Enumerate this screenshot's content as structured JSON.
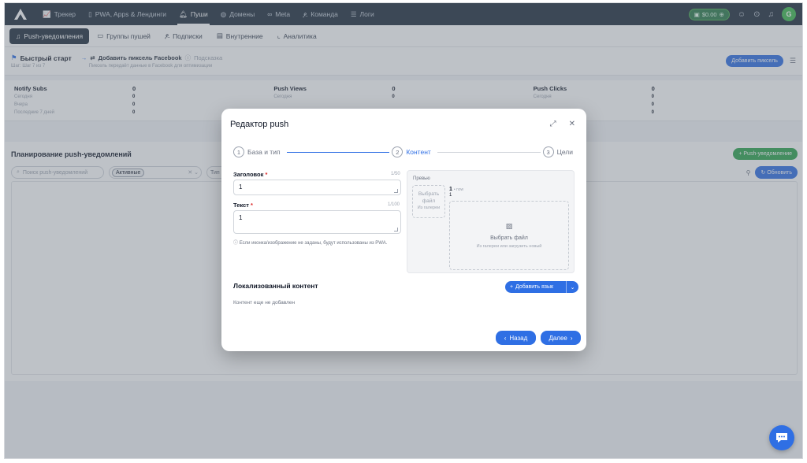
{
  "topnav": {
    "items": [
      {
        "label": "Трекер",
        "icon": "chart-line-icon"
      },
      {
        "label": "PWA, Apps & Лендинги",
        "icon": "phone-icon"
      },
      {
        "label": "Пуши",
        "icon": "bell-icon"
      },
      {
        "label": "Домены",
        "icon": "globe-icon"
      },
      {
        "label": "Meta",
        "icon": "meta-icon"
      },
      {
        "label": "Команда",
        "icon": "team-icon"
      },
      {
        "label": "Логи",
        "icon": "list-icon"
      }
    ],
    "balance": "$0.00",
    "avatar": "G"
  },
  "subnav": {
    "items": [
      {
        "label": "Push-уведомления"
      },
      {
        "label": "Группы пушей"
      },
      {
        "label": "Подписки"
      },
      {
        "label": "Внутренние"
      },
      {
        "label": "Аналитика"
      }
    ]
  },
  "quickstart": {
    "title": "Быстрый старт",
    "step": "Шаг: Шаг 7 из 7",
    "action": "Добавить пиксель Facebook",
    "hint": "Подсказка",
    "desc": "Пиксель передаёт данные в Facebook для оптимизации",
    "button": "Добавить пиксель"
  },
  "stats": [
    {
      "title": "Notify Subs",
      "rows": [
        {
          "label": "Сегодня",
          "value": "0"
        },
        {
          "label": "Вчера",
          "value": "0"
        },
        {
          "label": "Последние 7 дней",
          "value": "0"
        }
      ],
      "head_value": "0"
    },
    {
      "title": "Push Views",
      "rows": [
        {
          "label": "Сегодня",
          "value": "0"
        },
        {
          "label": "",
          "value": ""
        },
        {
          "label": "",
          "value": ""
        }
      ],
      "head_value": "0"
    },
    {
      "title": "Push Clicks",
      "rows": [
        {
          "label": "Сегодня",
          "value": "0"
        },
        {
          "label": "",
          "value": "0"
        },
        {
          "label": "",
          "value": "0"
        }
      ],
      "head_value": "0"
    }
  ],
  "planning": {
    "title": "Планирование push-уведомлений",
    "search_placeholder": "Поиск push-уведомлений",
    "status_tag": "Активные",
    "type_placeholder": "Тип",
    "new_button": "Push-уведомление",
    "refresh_button": "Обновить"
  },
  "modal": {
    "title": "Редактор push",
    "steps": [
      {
        "num": "1",
        "label": "База и тип"
      },
      {
        "num": "2",
        "label": "Контент"
      },
      {
        "num": "3",
        "label": "Цели"
      }
    ],
    "heading_label": "Заголовок",
    "heading_counter": "1/50",
    "heading_value": "1",
    "text_label": "Текст",
    "text_counter": "1/100",
    "text_value": "1",
    "required_mark": "*",
    "note": "Если иконка/изображение не заданы, будут использованы из PWA.",
    "preview": {
      "label": "Превью",
      "icon_drop_line1": "Выбрать",
      "icon_drop_line2": "файл",
      "icon_drop_sub": "Из галереи",
      "notif_title": "1",
      "notif_time": "• now",
      "notif_text": "1",
      "image_drop_title": "Выбрать файл",
      "image_drop_sub": "Из галереи или загрузить новый"
    },
    "localized_title": "Локализованный контент",
    "add_lang": "Добавить язык",
    "no_content": "Контент еще не добавлен",
    "back": "Назад",
    "next": "Далее"
  }
}
